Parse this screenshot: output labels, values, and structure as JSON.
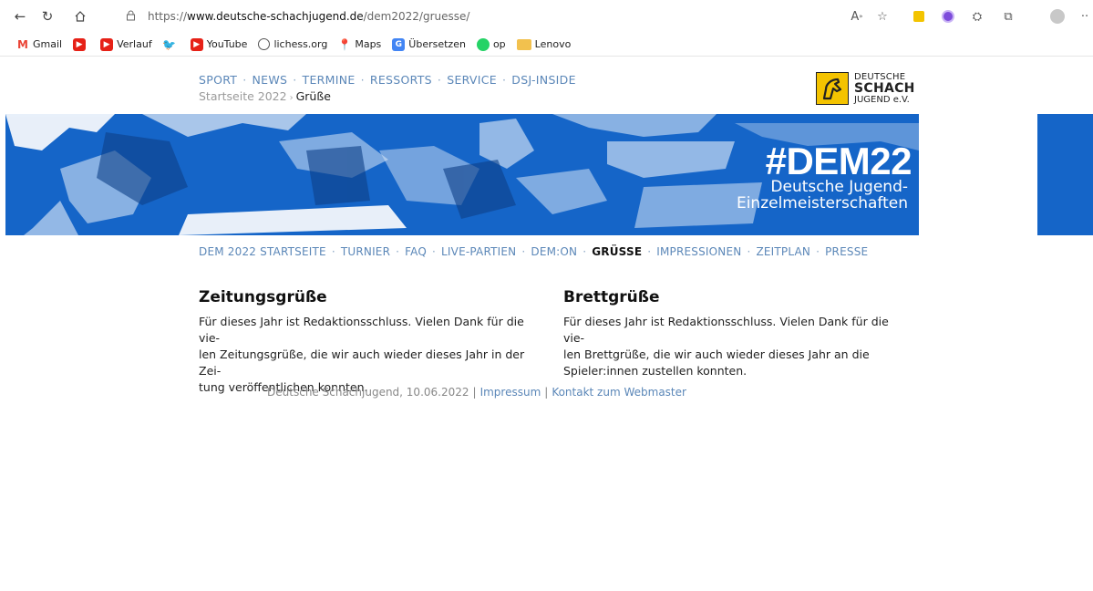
{
  "browser": {
    "url_prefix": "https://",
    "url_domain": "www.deutsche-schachjugend.de",
    "url_path": "/dem2022/gruesse/",
    "bookmarks": [
      {
        "label": "Gmail",
        "icon": "gmail-icon",
        "color": "#ea4335"
      },
      {
        "label": "",
        "icon": "youtube-icon",
        "color": "#e62117"
      },
      {
        "label": "Verlauf",
        "icon": "youtube-icon",
        "color": "#e62117"
      },
      {
        "label": "",
        "icon": "twitter-icon",
        "color": "#1d9bf0"
      },
      {
        "label": "YouTube",
        "icon": "youtube-icon",
        "color": "#e62117"
      },
      {
        "label": "lichess.org",
        "icon": "lichess-icon",
        "color": "#555555"
      },
      {
        "label": "Maps",
        "icon": "maps-icon",
        "color": "#34a853"
      },
      {
        "label": "Übersetzen",
        "icon": "translate-icon",
        "color": "#4285f4"
      },
      {
        "label": "op",
        "icon": "whatsapp-icon",
        "color": "#25d366"
      },
      {
        "label": "Lenovo",
        "icon": "folder-icon",
        "color": "#f2c14e"
      }
    ]
  },
  "header": {
    "nav": [
      "SPORT",
      "NEWS",
      "TERMINE",
      "RESSORTS",
      "SERVICE",
      "DSJ-INSIDE"
    ],
    "breadcrumb_home": "Startseite 2022",
    "breadcrumb_current": "Grüße",
    "logo": {
      "line1": "DEUTSCHE",
      "line2": "SCHACH",
      "line3": "JUGEND e.V."
    }
  },
  "banner": {
    "title": "#DEM22",
    "subtitle_line1": "Deutsche Jugend-",
    "subtitle_line2": "Einzelmeisterschaften",
    "color": "#1565c8"
  },
  "subnav": {
    "items": [
      "DEM 2022 STARTSEITE",
      "TURNIER",
      "FAQ",
      "LIVE-PARTIEN",
      "DEM:ON",
      "GRÜSSE",
      "IMPRESSIONEN",
      "ZEITPLAN",
      "PRESSE"
    ],
    "active": "GRÜSSE"
  },
  "content": {
    "left": {
      "title": "Zeitungsgrüße",
      "line1": "Für dieses Jahr ist Redaktionsschluss. Vielen Dank für die vie-",
      "line2": "len Zeitungsgrüße, die wir auch wieder dieses Jahr in der Zei-",
      "line3": "tung veröffentlichen konnten."
    },
    "right": {
      "title": "Brettgrüße",
      "line1": "Für dieses Jahr ist Redaktionsschluss. Vielen Dank für die vie-",
      "line2": "len Brettgrüße, die wir auch wieder dieses Jahr an die",
      "line3": "Spieler:innen zustellen konnten."
    }
  },
  "footer": {
    "text": "Deutsche Schachjugend, 10.06.2022",
    "impressum": "Impressum",
    "contact": "Kontakt zum Webmaster"
  }
}
